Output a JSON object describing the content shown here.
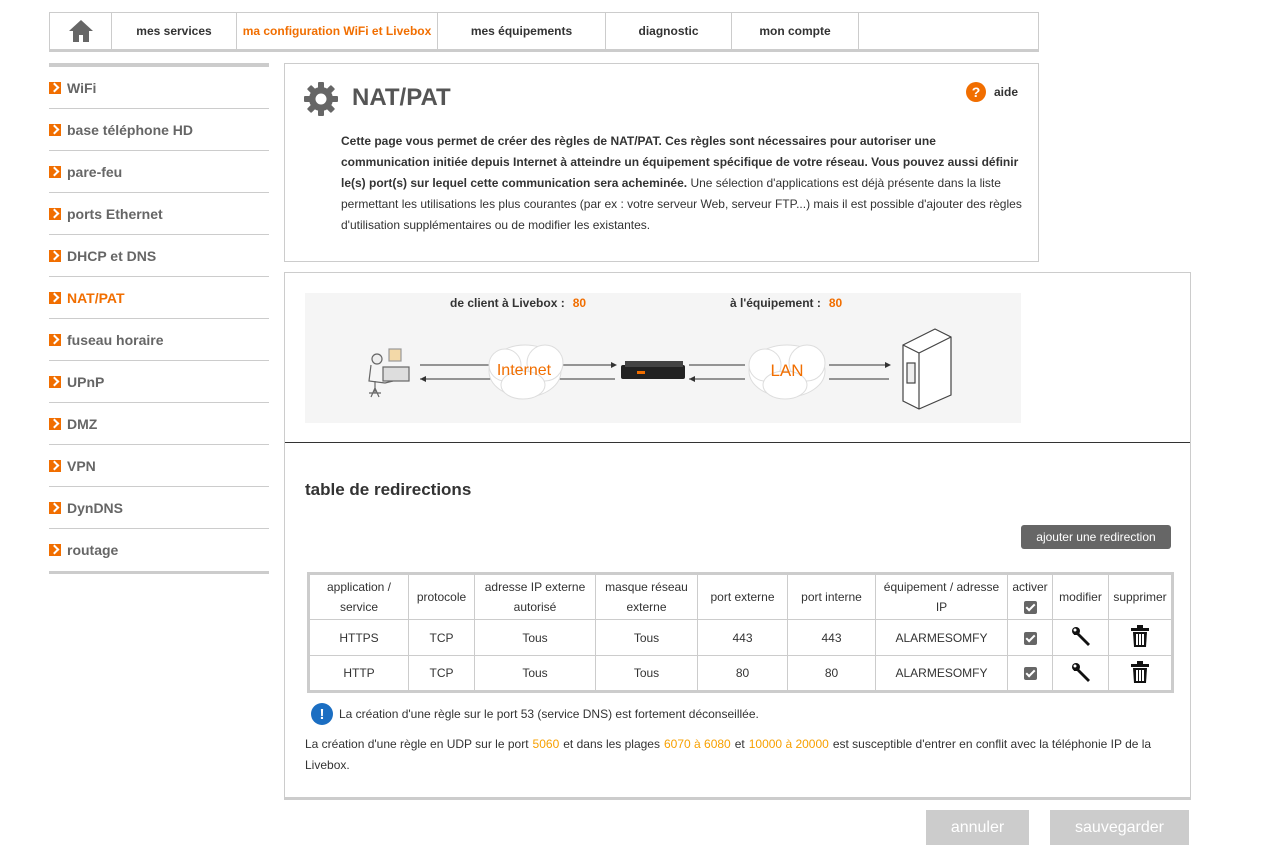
{
  "nav": {
    "tabs": [
      {
        "label": "mes services"
      },
      {
        "label": "ma configuration WiFi et Livebox"
      },
      {
        "label": "mes équipements"
      },
      {
        "label": "diagnostic"
      },
      {
        "label": "mon compte"
      }
    ]
  },
  "sidebar": {
    "items": [
      {
        "label": "WiFi"
      },
      {
        "label": "base téléphone HD"
      },
      {
        "label": "pare-feu"
      },
      {
        "label": "ports Ethernet"
      },
      {
        "label": "DHCP et DNS"
      },
      {
        "label": "NAT/PAT"
      },
      {
        "label": "fuseau horaire"
      },
      {
        "label": "UPnP"
      },
      {
        "label": "DMZ"
      },
      {
        "label": "VPN"
      },
      {
        "label": "DynDNS"
      },
      {
        "label": "routage"
      }
    ]
  },
  "header": {
    "title": "NAT/PAT",
    "help_label": "aide",
    "help_icon": "?",
    "desc_bold": "Cette page vous permet de créer des règles de NAT/PAT. Ces règles sont nécessaires pour autoriser une communication initiée depuis Internet à atteindre un équipement spécifique de votre réseau. Vous pouvez aussi définir le(s) port(s) sur lequel cette communication sera acheminée.",
    "desc_normal": " Une sélection d'applications est déjà présente dans la liste permettant les utilisations les plus courantes (par ex : votre serveur Web, serveur FTP...) mais il est possible d'ajouter des règles d'utilisation supplémentaires ou de modifier les existantes."
  },
  "diagram": {
    "client_label": "de client à Livebox :",
    "client_port": "80",
    "device_label": "à l'équipement :",
    "device_port": "80",
    "internet_label": "Internet",
    "lan_label": "LAN"
  },
  "table": {
    "title": "table de redirections",
    "add_button": "ajouter une redirection",
    "headers": {
      "application": "application / service",
      "protocol": "protocole",
      "ip_ext": "adresse IP externe autorisé",
      "mask": "masque réseau externe",
      "port_ext": "port externe",
      "port_int": "port interne",
      "device": "équipement / adresse IP",
      "activate": "activer",
      "modify": "modifier",
      "delete": "supprimer"
    },
    "rows": [
      {
        "app": "HTTPS",
        "protocol": "TCP",
        "ip_ext": "Tous",
        "mask": "Tous",
        "port_ext": "443",
        "port_int": "443",
        "device": "ALARMESOMFY"
      },
      {
        "app": "HTTP",
        "protocol": "TCP",
        "ip_ext": "Tous",
        "mask": "Tous",
        "port_ext": "80",
        "port_int": "80",
        "device": "ALARMESOMFY"
      }
    ]
  },
  "info": {
    "icon": "!",
    "text": "La création d'une règle sur le port 53 (service DNS) est fortement déconseillée."
  },
  "note": {
    "part1": "La création d'une règle en UDP sur le port",
    "port": "5060",
    "part2": "et dans les plages",
    "range1": "6070 à 6080",
    "part3": "et",
    "range2": "10000 à 20000",
    "part4": "est susceptible d'entrer en conflit avec la téléphonie IP de la Livebox."
  },
  "buttons": {
    "cancel": "annuler",
    "save": "sauvegarder"
  },
  "colors": {
    "accent": "#f16e00",
    "info_blue": "#1b6ec2",
    "note_orange": "#f7a000"
  }
}
